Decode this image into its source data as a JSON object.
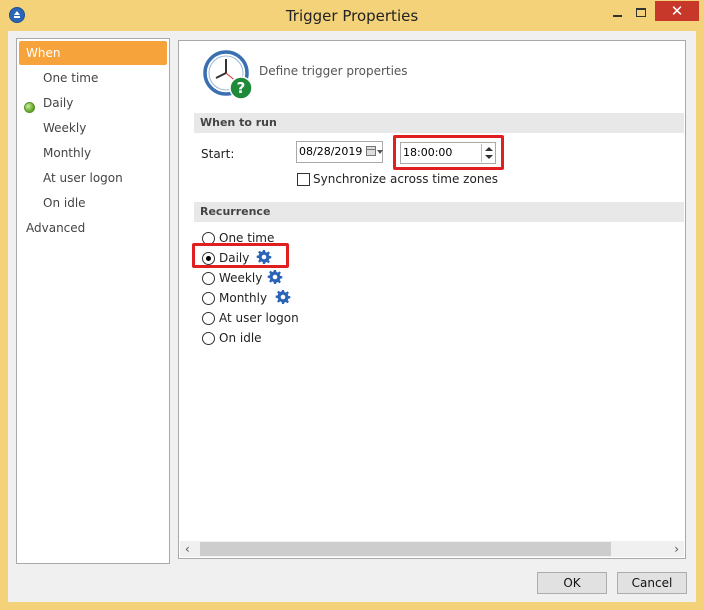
{
  "window": {
    "title": "Trigger Properties",
    "close_glyph": "✕"
  },
  "sidebar": {
    "items": [
      {
        "label": "When",
        "selected": true
      },
      {
        "label": "One time"
      },
      {
        "label": "Daily",
        "status": "active"
      },
      {
        "label": "Weekly"
      },
      {
        "label": "Monthly"
      },
      {
        "label": "At user logon"
      },
      {
        "label": "On idle"
      },
      {
        "label": "Advanced"
      }
    ]
  },
  "header": {
    "title": "Define trigger properties",
    "icon": "clock-help-icon"
  },
  "when_to_run": {
    "section_label": "When to run",
    "start_label": "Start:",
    "date_value": "08/28/2019",
    "time_value": "18:00:00",
    "sync_label": "Synchronize across time zones",
    "sync_checked": false
  },
  "recurrence": {
    "section_label": "Recurrence",
    "options": [
      {
        "label": "One time",
        "checked": false
      },
      {
        "label": "Daily",
        "checked": true
      },
      {
        "label": "Weekly",
        "checked": false
      },
      {
        "label": "Monthly",
        "checked": false
      },
      {
        "label": "At user logon",
        "checked": false
      },
      {
        "label": "On idle",
        "checked": false
      }
    ]
  },
  "buttons": {
    "ok": "OK",
    "cancel": "Cancel"
  },
  "colors": {
    "selection": "#f7a33c",
    "highlight": "#e02020",
    "gear": "#2a63b8"
  }
}
